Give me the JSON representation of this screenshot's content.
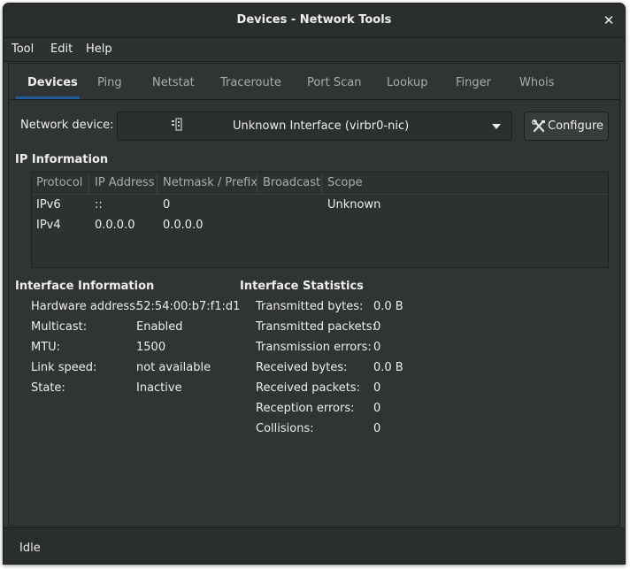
{
  "window": {
    "title": "Devices - Network Tools",
    "close_glyph": "✕"
  },
  "menu": [
    "Tool",
    "Edit",
    "Help"
  ],
  "tabs": [
    "Devices",
    "Ping",
    "Netstat",
    "Traceroute",
    "Port Scan",
    "Lookup",
    "Finger",
    "Whois"
  ],
  "device": {
    "label": "Network device:",
    "selected": "Unknown Interface (virbr0-nic)",
    "configure_label": "Configure"
  },
  "ip_info": {
    "title": "IP Information",
    "columns": [
      "Protocol",
      "IP Address",
      "Netmask / Prefix",
      "Broadcast",
      "Scope"
    ],
    "rows": [
      [
        "IPv6",
        "::",
        "0",
        "",
        "Unknown"
      ],
      [
        "IPv4",
        "0.0.0.0",
        "0.0.0.0",
        "",
        ""
      ]
    ]
  },
  "interface_info": {
    "title": "Interface Information",
    "items": [
      {
        "label": "Hardware address:",
        "value": "52:54:00:b7:f1:d1"
      },
      {
        "label": "Multicast:",
        "value": "Enabled"
      },
      {
        "label": "MTU:",
        "value": "1500"
      },
      {
        "label": "Link speed:",
        "value": "not available"
      },
      {
        "label": "State:",
        "value": "Inactive"
      }
    ]
  },
  "interface_stats": {
    "title": "Interface Statistics",
    "items": [
      {
        "label": "Transmitted bytes:",
        "value": "0.0 B"
      },
      {
        "label": "Transmitted packets:",
        "value": "0"
      },
      {
        "label": "Transmission errors:",
        "value": "0"
      },
      {
        "label": "Received bytes:",
        "value": "0.0 B"
      },
      {
        "label": "Received packets:",
        "value": "0"
      },
      {
        "label": "Reception errors:",
        "value": "0"
      },
      {
        "label": "Collisions:",
        "value": "0"
      }
    ]
  },
  "status": "Idle",
  "colors": {
    "accent": "#215d9c",
    "background": "#353839"
  }
}
